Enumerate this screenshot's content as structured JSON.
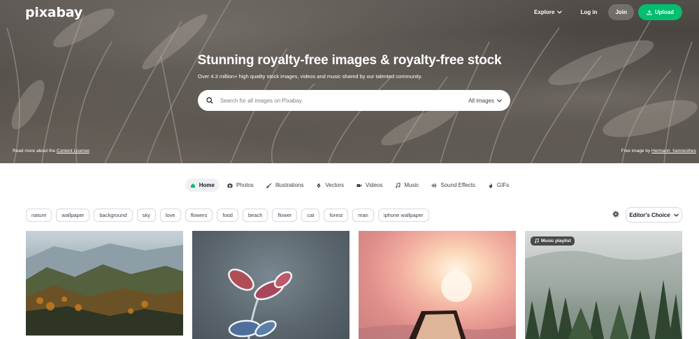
{
  "brand": {
    "logo": "pixabay"
  },
  "nav": {
    "explore": "Explore",
    "login": "Log in",
    "join": "Join",
    "upload": "Upload"
  },
  "hero": {
    "title": "Stunning royalty-free images & royalty-free stock",
    "subtitle": "Over 4.3 million+ high quality stock images, videos and music shared by our talented community.",
    "search_placeholder": "Search for all images on Pixabay",
    "search_filter": "All images",
    "footer_left_prefix": "Read more about the ",
    "footer_left_link": "Content License",
    "footer_right_prefix": "Free image by ",
    "footer_right_link": "Hermann_hannesthes"
  },
  "tabs": [
    {
      "label": "Home",
      "icon": "home-icon",
      "active": true
    },
    {
      "label": "Photos",
      "icon": "camera-icon"
    },
    {
      "label": "Illustrations",
      "icon": "brush-icon"
    },
    {
      "label": "Vectors",
      "icon": "pen-nib-icon"
    },
    {
      "label": "Videos",
      "icon": "video-icon"
    },
    {
      "label": "Music",
      "icon": "music-note-icon"
    },
    {
      "label": "Sound Effects",
      "icon": "waveform-icon"
    },
    {
      "label": "GIFs",
      "icon": "flame-icon"
    }
  ],
  "tags": [
    "nature",
    "wallpaper",
    "background",
    "sky",
    "love",
    "flowers",
    "food",
    "beach",
    "flower",
    "cat",
    "forest",
    "man",
    "iphone wallpaper"
  ],
  "sort": {
    "label": "Editor's Choice"
  },
  "gallery": {
    "badge": "Music playlist"
  },
  "colors": {
    "accent": "#02be6e",
    "text": "#191b26",
    "border": "#d6d8dd"
  }
}
